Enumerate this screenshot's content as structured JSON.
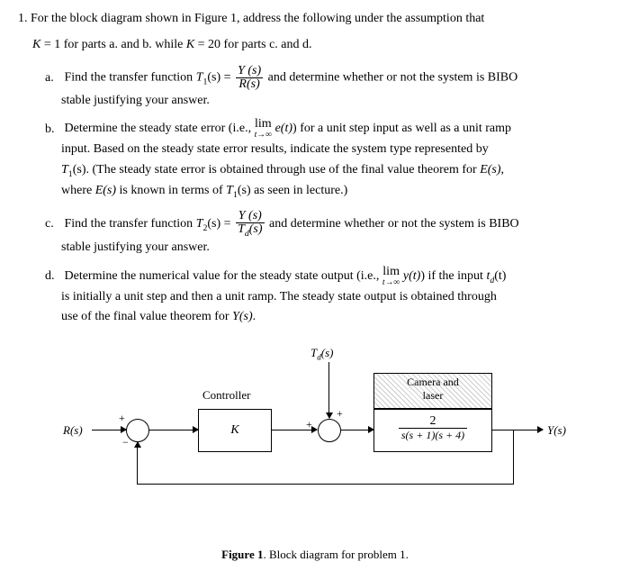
{
  "intro_line1": "1. For the block diagram shown in Figure 1, address the following under the assumption that",
  "intro_line2_a": "K",
  "intro_line2_b": " = 1 for parts a. and b. while ",
  "intro_line2_c": "K",
  "intro_line2_d": " = 20 for parts c. and d.",
  "a_label": "a.",
  "a1": "Find the transfer function ",
  "a_t1": "T",
  "a_sub1": "1",
  "a_paren": "(s) = ",
  "a_num": "Y (s)",
  "a_den": "R(s)",
  "a2": " and determine whether or not the system is BIBO",
  "a3": "stable justifying your answer.",
  "b_label": "b.",
  "b1": "Determine the steady state error (i.e., ",
  "b_lim": "lim",
  "b_lim_sub": "t→∞",
  "b_et": " e(t)",
  "b2": ") for a unit step input as well as a unit ramp",
  "b3": "input.  Based on the steady state error results, indicate the system type represented by",
  "b4a": "T",
  "b4sub": "1",
  "b4b": "(s). (The steady state error is obtained through use of the final value theorem for ",
  "b4c": "E(s)",
  "b4d": ",",
  "b5a": "where ",
  "b5b": "E(s)",
  "b5c": " is known in terms of ",
  "b5d": "T",
  "b5sub": "1",
  "b5e": "(s) as seen in lecture.)",
  "c_label": "c.",
  "c1": "Find the transfer function ",
  "c_t2": "T",
  "c_sub2": "2",
  "c_paren": "(s) = ",
  "c_num": "Y (s)",
  "c_den_a": "T",
  "c_den_sub": "d",
  "c_den_b": "(s)",
  "c2": " and determine whether or not the system is BIBO",
  "c3": "stable justifying your answer.",
  "d_label": "d.",
  "d1": "Determine the numerical value for the steady state output (i.e., ",
  "d_lim": "lim",
  "d_lim_sub": "t→∞",
  "d_yt": " y(t)",
  "d2": ") if the input ",
  "d_td": "t",
  "d_tdsub": "d",
  "d_tdb": "(t)",
  "d3": "is initially a unit step and then a unit ramp.  The steady state output is obtained through",
  "d4a": "use of the final value theorem for ",
  "d4b": "Y(s)",
  "d4c": ".",
  "diag": {
    "td": "T",
    "tdsub": "d",
    "tdparen": "(s)",
    "cam_laser_1": "Camera and",
    "cam_laser_2": "laser",
    "controller": "Controller",
    "K": "K",
    "plant_num": "2",
    "plant_den": "s(s + 1)(s + 4)",
    "R": "R(s)",
    "Y": "Y(s)",
    "plus": "+",
    "minus": "−"
  },
  "caption_a": "Figure 1",
  "caption_b": ". Block diagram for problem 1."
}
